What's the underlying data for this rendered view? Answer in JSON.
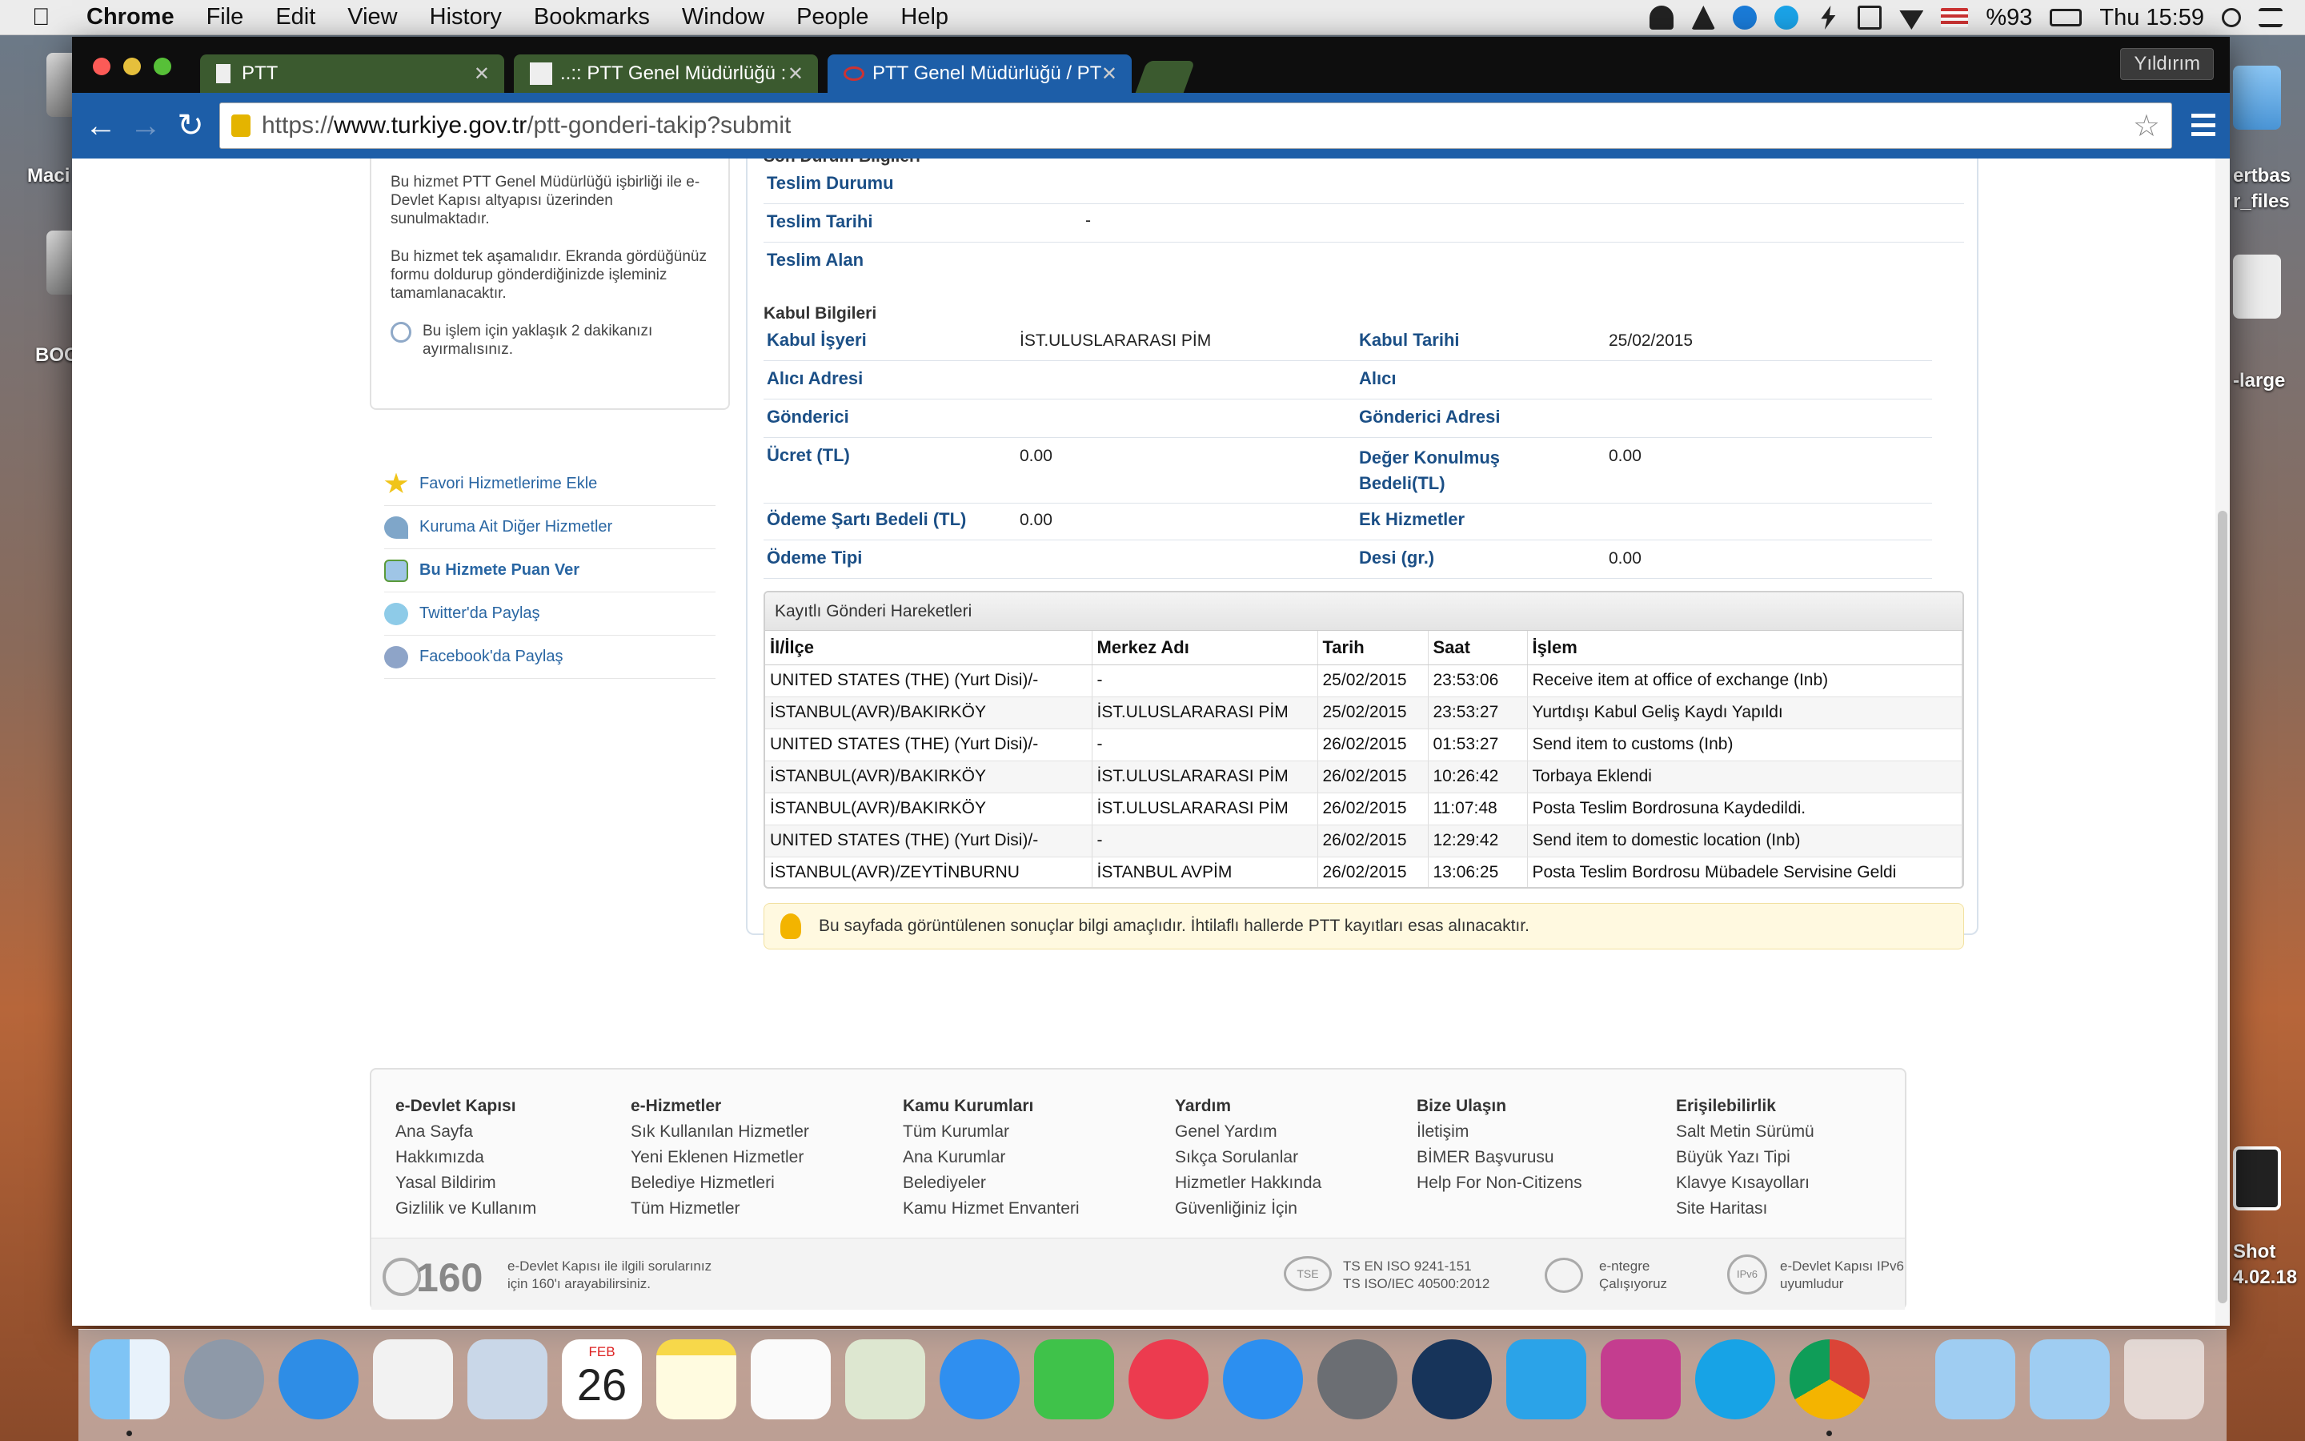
{
  "menubar": {
    "app": "Chrome",
    "items": [
      "File",
      "Edit",
      "View",
      "History",
      "Bookmarks",
      "Window",
      "People",
      "Help"
    ],
    "battery": "%93",
    "clock": "Thu 15:59"
  },
  "desktop": {
    "labels": [
      "Maci",
      "BOC",
      "ertbas",
      "r_files",
      "-large",
      "Shot",
      "4.02.18"
    ]
  },
  "browser": {
    "tabs": [
      {
        "title": "PTT",
        "active": false
      },
      {
        "title": "..:: PTT Genel Müdürlüğü :",
        "active": false
      },
      {
        "title": "PTT Genel Müdürlüğü / PT",
        "active": true
      }
    ],
    "profile": "Yıldırım",
    "url_scheme": "https://",
    "url_host": "www.turkiye.gov.tr",
    "url_path": "/ptt-gonderi-takip?submit"
  },
  "sidebar": {
    "info1": "Bu hizmet PTT Genel Müdürlüğü işbirliği ile e-Devlet Kapısı altyapısı üzerinden sunulmaktadır.",
    "info2": "Bu hizmet tek aşamalıdır. Ekranda gördüğünüz formu doldurup gönderdiğinizde işleminiz tamamlanacaktır.",
    "time_note": "Bu işlem için yaklaşık 2 dakikanızı ayırmalısınız.",
    "links": [
      {
        "label": "Favori Hizmetlerime Ekle",
        "icon": "star-icon",
        "bold": false
      },
      {
        "label": "Kuruma Ait Diğer Hizmetler",
        "icon": "arrow-icon",
        "bold": false
      },
      {
        "label": "Bu Hizmete Puan Ver",
        "icon": "rating-icon",
        "bold": true
      },
      {
        "label": "Twitter'da Paylaş",
        "icon": "twitter-icon",
        "bold": false
      },
      {
        "label": "Facebook'da Paylaş",
        "icon": "facebook-icon",
        "bold": false
      }
    ]
  },
  "son_durum": {
    "title": "Son Durum Bilgileri",
    "teslim_durumu_label": "Teslim Durumu",
    "teslim_tarihi_label": "Teslim Tarihi",
    "teslim_tarihi_value": "-",
    "teslim_alan_label": "Teslim Alan"
  },
  "kabul": {
    "title": "Kabul Bilgileri",
    "kabul_isyeri_label": "Kabul İşyeri",
    "kabul_isyeri_value": "İST.ULUSLARARASI PİM",
    "kabul_tarihi_label": "Kabul Tarihi",
    "kabul_tarihi_value": "25/02/2015",
    "alici_adresi_label": "Alıcı Adresi",
    "alici_label": "Alıcı",
    "gonderici_label": "Gönderici",
    "gonderici_adresi_label": "Gönderici Adresi",
    "ucret_label": "Ücret (TL)",
    "ucret_value": "0.00",
    "deger_label": "Değer Konulmuş Bedeli(TL)",
    "deger_value": "0.00",
    "odeme_sarti_label": "Ödeme Şartı Bedeli (TL)",
    "odeme_sarti_value": "0.00",
    "ek_hizmetler_label": "Ek Hizmetler",
    "odeme_tipi_label": "Ödeme Tipi",
    "desi_label": "Desi (gr.)",
    "desi_value": "0.00"
  },
  "movements": {
    "title": "Kayıtlı Gönderi Hareketleri",
    "columns": [
      "İl/İlçe",
      "Merkez Adı",
      "Tarih",
      "Saat",
      "İşlem"
    ],
    "rows": [
      [
        "UNITED STATES (THE) (Yurt Disi)/-",
        "-",
        "25/02/2015",
        "23:53:06",
        "Receive item at office of exchange (Inb)"
      ],
      [
        "İSTANBUL(AVR)/BAKIRKÖY",
        "İST.ULUSLARARASI PİM",
        "25/02/2015",
        "23:53:27",
        "Yurtdışı Kabul Geliş Kaydı Yapıldı"
      ],
      [
        "UNITED STATES (THE) (Yurt Disi)/-",
        "-",
        "26/02/2015",
        "01:53:27",
        "Send item to customs (Inb)"
      ],
      [
        "İSTANBUL(AVR)/BAKIRKÖY",
        "İST.ULUSLARARASI PİM",
        "26/02/2015",
        "10:26:42",
        "Torbaya Eklendi"
      ],
      [
        "İSTANBUL(AVR)/BAKIRKÖY",
        "İST.ULUSLARARASI PİM",
        "26/02/2015",
        "11:07:48",
        "Posta Teslim Bordrosuna Kaydedildi."
      ],
      [
        "UNITED STATES (THE) (Yurt Disi)/-",
        "-",
        "26/02/2015",
        "12:29:42",
        "Send item to domestic location (Inb)"
      ],
      [
        "İSTANBUL(AVR)/ZEYTİNBURNU",
        "İSTANBUL AVPİM",
        "26/02/2015",
        "13:06:25",
        "Posta Teslim Bordrosu Mübadele Servisine Geldi"
      ]
    ]
  },
  "notice": "Bu sayfada görüntülenen sonuçlar bilgi amaçlıdır. İhtilaflı hallerde PTT kayıtları esas alınacaktır.",
  "footer": {
    "columns": [
      {
        "title": "e-Devlet Kapısı",
        "links": [
          "Ana Sayfa",
          "Hakkımızda",
          "Yasal Bildirim",
          "Gizlilik ve Kullanım"
        ]
      },
      {
        "title": "e-Hizmetler",
        "links": [
          "Sık Kullanılan Hizmetler",
          "Yeni Eklenen Hizmetler",
          "Belediye Hizmetleri",
          "Tüm Hizmetler"
        ]
      },
      {
        "title": "Kamu Kurumları",
        "links": [
          "Tüm Kurumlar",
          "Ana Kurumlar",
          "Belediyeler",
          "Kamu Hizmet Envanteri"
        ]
      },
      {
        "title": "Yardım",
        "links": [
          "Genel Yardım",
          "Sıkça Sorulanlar",
          "Hizmetler Hakkında",
          "Güvenliğiniz İçin"
        ]
      },
      {
        "title": "Bize Ulaşın",
        "links": [
          "İletişim",
          "BİMER Başvurusu",
          "Help For Non-Citizens"
        ]
      },
      {
        "title": "Erişilebilirlik",
        "links": [
          "Salt Metin Sürümü",
          "Büyük Yazı Tipi",
          "Klavye Kısayolları",
          "Site Haritası"
        ]
      }
    ],
    "hotline_number": "160",
    "hotline_text_1": "e-Devlet Kapısı ile ilgili sorularınız",
    "hotline_text_2": "için 160'ı arayabilirsiniz.",
    "iso_1": "TS EN ISO 9241-151",
    "iso_2": "TS ISO/IEC 40500:2012",
    "entegre_1": "e-ntegre",
    "entegre_2": "Çalışıyoruz",
    "ipv6_1": "e-Devlet Kapısı IPv6",
    "ipv6_2": "uyumludur",
    "tse_logo": "TSE",
    "ipv6_logo": "IPv6"
  },
  "dock": {
    "calendar_month": "FEB",
    "calendar_day": "26"
  }
}
